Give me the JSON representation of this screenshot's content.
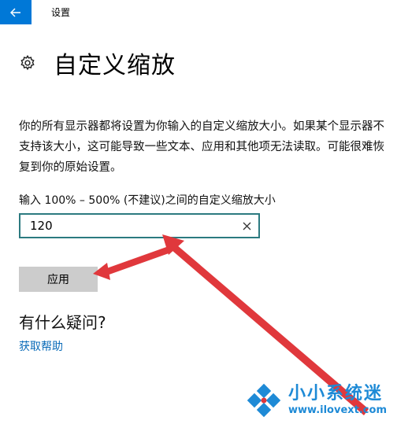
{
  "window": {
    "title": "设置",
    "back_icon": "arrow-left-icon",
    "accent_color": "#0078d7"
  },
  "header": {
    "icon": "gear-icon",
    "title": "自定义缩放"
  },
  "description": "你的所有显示器都将设置为你输入的自定义缩放大小。如果某个显示器不支持该大小，这可能导致一些文本、应用和其他项无法读取。可能很难恢复到你的原始设置。",
  "scale_input": {
    "label": "输入 100% – 500% (不建议)之间的自定义缩放大小",
    "value": "120",
    "clear_icon": "close-icon"
  },
  "apply_button": {
    "label": "应用"
  },
  "help": {
    "heading": "有什么疑问?",
    "link": "获取帮助"
  },
  "annotation": {
    "arrow_color": "#e0383c"
  },
  "watermark": {
    "name": "小小系统迷",
    "url": "www.ilovext.com"
  }
}
